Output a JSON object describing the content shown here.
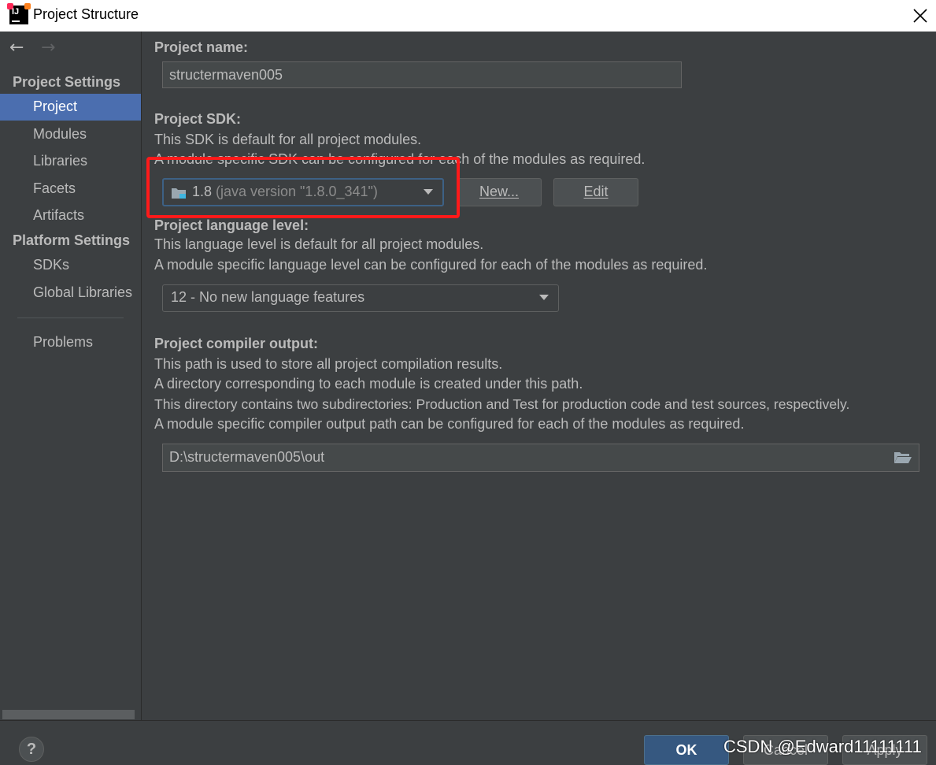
{
  "window": {
    "title": "Project Structure",
    "logo_text": "IJ"
  },
  "sidebar": {
    "project_settings_title": "Project Settings",
    "project_items": [
      {
        "label": "Project"
      },
      {
        "label": "Modules"
      },
      {
        "label": "Libraries"
      },
      {
        "label": "Facets"
      },
      {
        "label": "Artifacts"
      }
    ],
    "platform_settings_title": "Platform Settings",
    "platform_items": [
      {
        "label": "SDKs"
      },
      {
        "label": "Global Libraries"
      }
    ],
    "problems_label": "Problems"
  },
  "main": {
    "project_name_label": "Project name:",
    "project_name_value": "structermaven005",
    "sdk_label": "Project SDK:",
    "sdk_desc1": "This SDK is default for all project modules.",
    "sdk_desc2": "A module specific SDK can be configured for each of the modules as required.",
    "sdk_selected": "1.8",
    "sdk_selected_detail": "(java version \"1.8.0_341\")",
    "new_button": "New...",
    "edit_button": "Edit",
    "lang_label": "Project language level:",
    "lang_desc1": "This language level is default for all project modules.",
    "lang_desc2": "A module specific language level can be configured for each of the modules as required.",
    "lang_selected": "12 - No new language features",
    "output_label": "Project compiler output:",
    "output_desc1": "This path is used to store all project compilation results.",
    "output_desc2": "A directory corresponding to each module is created under this path.",
    "output_desc3": "This directory contains two subdirectories: Production and Test for production code and test sources, respectively.",
    "output_desc4": "A module specific compiler output path can be configured for each of the modules as required.",
    "output_path": "D:\\structermaven005\\out"
  },
  "footer": {
    "help": "?",
    "ok": "OK",
    "cancel": "Cancel",
    "apply": "Apply",
    "watermark": "CSDN @Edward11111111"
  },
  "colors": {
    "accent_selection": "#4b6eaf",
    "highlight_box": "#ff1a1a",
    "ok_button": "#365880"
  }
}
